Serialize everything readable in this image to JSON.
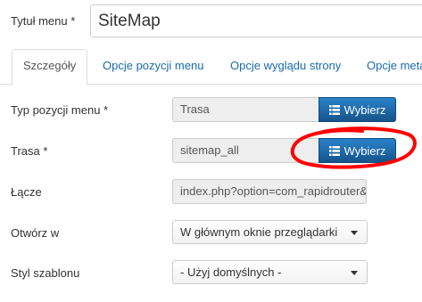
{
  "menu_title": {
    "label": "Tytuł menu *",
    "value": "SiteMap"
  },
  "tabs": [
    {
      "label": "Szczegóły"
    },
    {
      "label": "Opcje pozycji menu"
    },
    {
      "label": "Opcje wyglądu strony"
    },
    {
      "label": "Opcje meta"
    }
  ],
  "item_type": {
    "label": "Typ pozycji menu *",
    "value": "Trasa",
    "button": "Wybierz"
  },
  "route": {
    "label": "Trasa *",
    "value": "sitemap_all",
    "button": "Wybierz"
  },
  "link": {
    "label": "Łącze",
    "value": "index.php?option=com_rapidrouter&"
  },
  "open_in": {
    "label": "Otwórz w",
    "value": "W głównym oknie przeglądarki"
  },
  "template_style": {
    "label": "Styl szablonu",
    "value": "- Użyj domyślnych -"
  },
  "colors": {
    "accent": "#1a6bac",
    "button": "#1e6aa8",
    "annotation": "#ff0000"
  },
  "icons": {
    "button_icon": "list-icon",
    "select_icon": "caret-down-icon"
  }
}
